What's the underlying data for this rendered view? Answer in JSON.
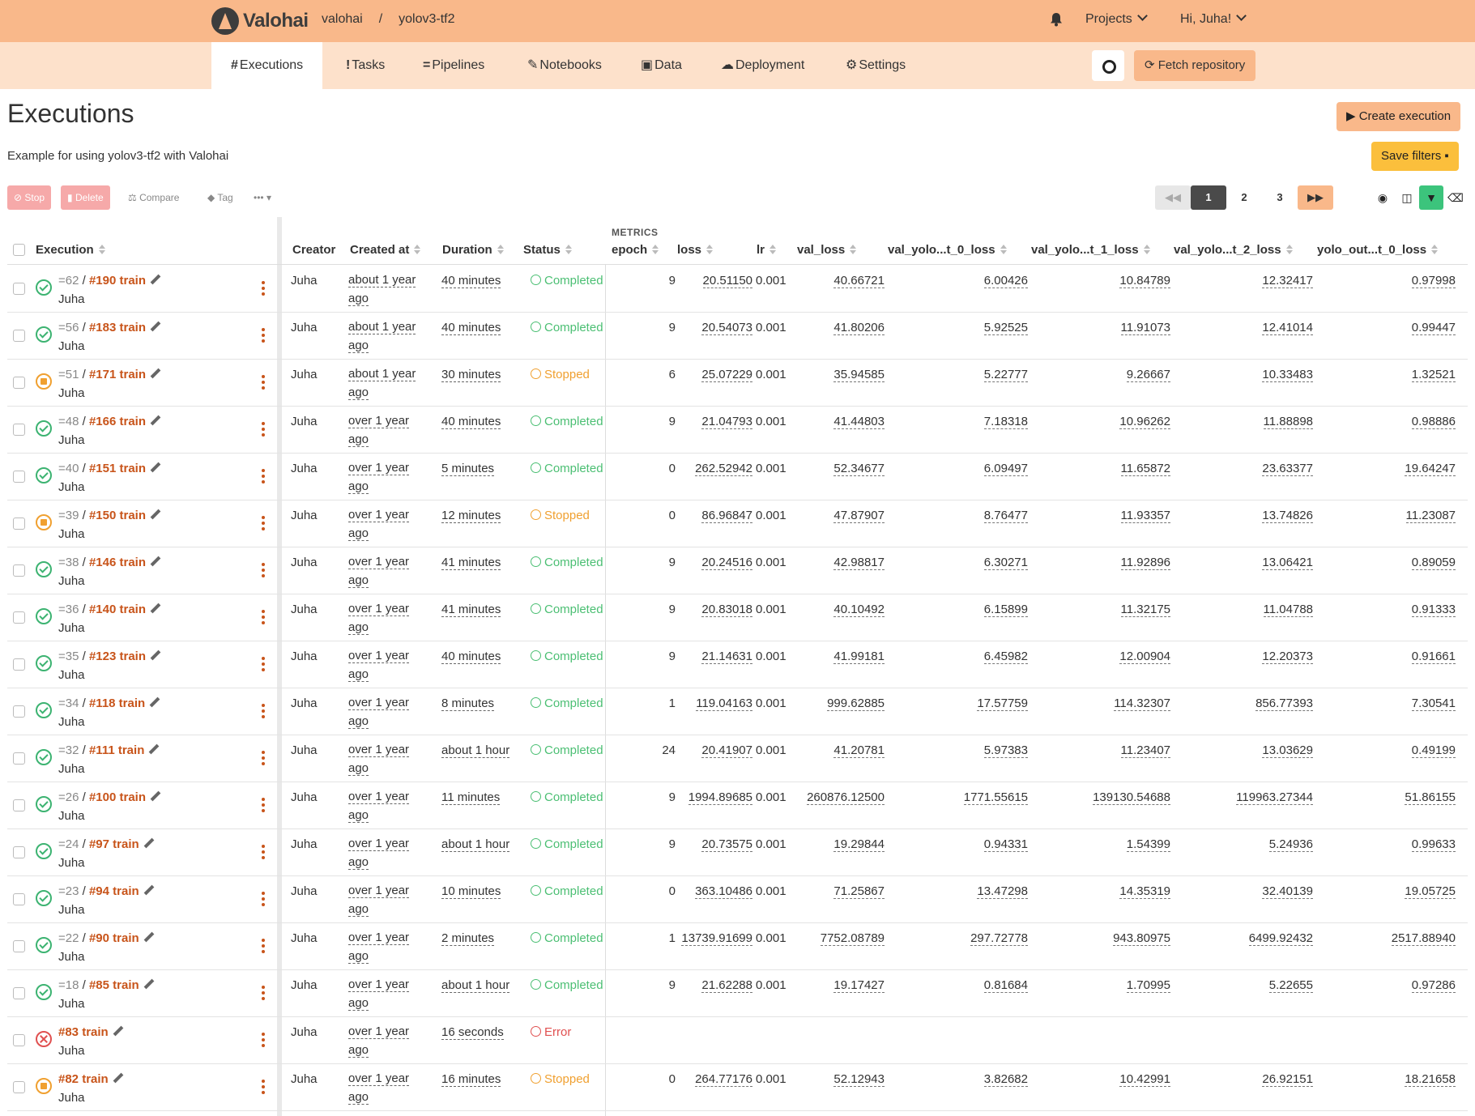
{
  "brand": {
    "name": "Valohai"
  },
  "breadcrumb": {
    "org": "valohai",
    "sep": "/",
    "project": "yolov3-tf2"
  },
  "topnav": {
    "projects": "Projects",
    "user": "Hi, Juha!"
  },
  "tabs": [
    {
      "icon": "#",
      "label": "Executions"
    },
    {
      "icon": "!",
      "label": "Tasks"
    },
    {
      "icon": "=",
      "label": "Pipelines"
    },
    {
      "icon": "✎",
      "label": "Notebooks"
    },
    {
      "icon": "▣",
      "label": "Data"
    },
    {
      "icon": "☁",
      "label": "Deployment"
    },
    {
      "icon": "⚙",
      "label": "Settings"
    }
  ],
  "fetch_label": "Fetch repository",
  "page": {
    "title": "Executions",
    "description": "Example for using yolov3-tf2 with Valohai"
  },
  "buttons": {
    "create": "Create execution",
    "save_filters": "Save filters",
    "stop": "Stop",
    "delete": "Delete",
    "compare": "Compare",
    "tag": "Tag",
    "more": "•••"
  },
  "pagination": {
    "pages": [
      "1",
      "2",
      "3"
    ],
    "current": "1"
  },
  "columns": {
    "execution": "Execution",
    "creator": "Creator",
    "created_at": "Created at",
    "duration": "Duration",
    "status": "Status",
    "metrics_group": "METRICS",
    "epoch": "epoch",
    "loss": "loss",
    "lr": "lr",
    "val_loss": "val_loss",
    "v0": "val_yolo...t_0_loss",
    "v1": "val_yolo...t_1_loss",
    "v2": "val_yolo...t_2_loss",
    "y0": "yolo_out...t_0_loss"
  },
  "rows": [
    {
      "counter": "=62",
      "sep": "/",
      "num": "#190 train",
      "user": "Juha",
      "creator": "Juha",
      "c1": "about 1 year",
      "c2": "ago",
      "duration": "40 minutes",
      "status": "Completed",
      "epoch": "9",
      "loss": "20.51150",
      "lr": "0.001",
      "val_loss": "40.66721",
      "v0": "6.00426",
      "v1": "10.84789",
      "v2": "12.32417",
      "y0": "0.97998"
    },
    {
      "counter": "=56",
      "sep": "/",
      "num": "#183 train",
      "user": "Juha",
      "creator": "Juha",
      "c1": "about 1 year",
      "c2": "ago",
      "duration": "40 minutes",
      "status": "Completed",
      "epoch": "9",
      "loss": "20.54073",
      "lr": "0.001",
      "val_loss": "41.80206",
      "v0": "5.92525",
      "v1": "11.91073",
      "v2": "12.41014",
      "y0": "0.99447"
    },
    {
      "counter": "=51",
      "sep": "/",
      "num": "#171 train",
      "user": "Juha",
      "creator": "Juha",
      "c1": "about 1 year",
      "c2": "ago",
      "duration": "30 minutes",
      "status": "Stopped",
      "epoch": "6",
      "loss": "25.07229",
      "lr": "0.001",
      "val_loss": "35.94585",
      "v0": "5.22777",
      "v1": "9.26667",
      "v2": "10.33483",
      "y0": "1.32521"
    },
    {
      "counter": "=48",
      "sep": "/",
      "num": "#166 train",
      "user": "Juha",
      "creator": "Juha",
      "c1": "over 1 year",
      "c2": "ago",
      "duration": "40 minutes",
      "status": "Completed",
      "epoch": "9",
      "loss": "21.04793",
      "lr": "0.001",
      "val_loss": "41.44803",
      "v0": "7.18318",
      "v1": "10.96262",
      "v2": "11.88898",
      "y0": "0.98886"
    },
    {
      "counter": "=40",
      "sep": "/",
      "num": "#151 train",
      "user": "Juha",
      "creator": "Juha",
      "c1": "over 1 year",
      "c2": "ago",
      "duration": "5 minutes",
      "status": "Completed",
      "epoch": "0",
      "loss": "262.52942",
      "lr": "0.001",
      "val_loss": "52.34677",
      "v0": "6.09497",
      "v1": "11.65872",
      "v2": "23.63377",
      "y0": "19.64247"
    },
    {
      "counter": "=39",
      "sep": "/",
      "num": "#150 train",
      "user": "Juha",
      "creator": "Juha",
      "c1": "over 1 year",
      "c2": "ago",
      "duration": "12 minutes",
      "status": "Stopped",
      "epoch": "0",
      "loss": "86.96847",
      "lr": "0.001",
      "val_loss": "47.87907",
      "v0": "8.76477",
      "v1": "11.93357",
      "v2": "13.74826",
      "y0": "11.23087"
    },
    {
      "counter": "=38",
      "sep": "/",
      "num": "#146 train",
      "user": "Juha",
      "creator": "Juha",
      "c1": "over 1 year",
      "c2": "ago",
      "duration": "41 minutes",
      "status": "Completed",
      "epoch": "9",
      "loss": "20.24516",
      "lr": "0.001",
      "val_loss": "42.98817",
      "v0": "6.30271",
      "v1": "11.92896",
      "v2": "13.06421",
      "y0": "0.89059"
    },
    {
      "counter": "=36",
      "sep": "/",
      "num": "#140 train",
      "user": "Juha",
      "creator": "Juha",
      "c1": "over 1 year",
      "c2": "ago",
      "duration": "41 minutes",
      "status": "Completed",
      "epoch": "9",
      "loss": "20.83018",
      "lr": "0.001",
      "val_loss": "40.10492",
      "v0": "6.15899",
      "v1": "11.32175",
      "v2": "11.04788",
      "y0": "0.91333"
    },
    {
      "counter": "=35",
      "sep": "/",
      "num": "#123 train",
      "user": "Juha",
      "creator": "Juha",
      "c1": "over 1 year",
      "c2": "ago",
      "duration": "40 minutes",
      "status": "Completed",
      "epoch": "9",
      "loss": "21.14631",
      "lr": "0.001",
      "val_loss": "41.99181",
      "v0": "6.45982",
      "v1": "12.00904",
      "v2": "12.20373",
      "y0": "0.91661"
    },
    {
      "counter": "=34",
      "sep": "/",
      "num": "#118 train",
      "user": "Juha",
      "creator": "Juha",
      "c1": "over 1 year",
      "c2": "ago",
      "duration": "8 minutes",
      "status": "Completed",
      "epoch": "1",
      "loss": "119.04163",
      "lr": "0.001",
      "val_loss": "999.62885",
      "v0": "17.57759",
      "v1": "114.32307",
      "v2": "856.77393",
      "y0": "7.30541"
    },
    {
      "counter": "=32",
      "sep": "/",
      "num": "#111 train",
      "user": "Juha",
      "creator": "Juha",
      "c1": "over 1 year",
      "c2": "ago",
      "duration": "about 1 hour",
      "status": "Completed",
      "epoch": "24",
      "loss": "20.41907",
      "lr": "0.001",
      "val_loss": "41.20781",
      "v0": "5.97383",
      "v1": "11.23407",
      "v2": "13.03629",
      "y0": "0.49199"
    },
    {
      "counter": "=26",
      "sep": "/",
      "num": "#100 train",
      "user": "Juha",
      "creator": "Juha",
      "c1": "over 1 year",
      "c2": "ago",
      "duration": "11 minutes",
      "status": "Completed",
      "epoch": "9",
      "loss": "1994.89685",
      "lr": "0.001",
      "val_loss": "260876.12500",
      "v0": "1771.55615",
      "v1": "139130.54688",
      "v2": "119963.27344",
      "y0": "51.86155"
    },
    {
      "counter": "=24",
      "sep": "/",
      "num": "#97 train",
      "user": "Juha",
      "creator": "Juha",
      "c1": "over 1 year",
      "c2": "ago",
      "duration": "about 1 hour",
      "status": "Completed",
      "epoch": "9",
      "loss": "20.73575",
      "lr": "0.001",
      "val_loss": "19.29844",
      "v0": "0.94331",
      "v1": "1.54399",
      "v2": "5.24936",
      "y0": "0.99633"
    },
    {
      "counter": "=23",
      "sep": "/",
      "num": "#94 train",
      "user": "Juha",
      "creator": "Juha",
      "c1": "over 1 year",
      "c2": "ago",
      "duration": "10 minutes",
      "status": "Completed",
      "epoch": "0",
      "loss": "363.10486",
      "lr": "0.001",
      "val_loss": "71.25867",
      "v0": "13.47298",
      "v1": "14.35319",
      "v2": "32.40139",
      "y0": "19.05725"
    },
    {
      "counter": "=22",
      "sep": "/",
      "num": "#90 train",
      "user": "Juha",
      "creator": "Juha",
      "c1": "over 1 year",
      "c2": "ago",
      "duration": "2 minutes",
      "status": "Completed",
      "epoch": "1",
      "loss": "13739.91699",
      "lr": "0.001",
      "val_loss": "7752.08789",
      "v0": "297.72778",
      "v1": "943.80975",
      "v2": "6499.92432",
      "y0": "2517.88940"
    },
    {
      "counter": "=18",
      "sep": "/",
      "num": "#85 train",
      "user": "Juha",
      "creator": "Juha",
      "c1": "over 1 year",
      "c2": "ago",
      "duration": "about 1 hour",
      "status": "Completed",
      "epoch": "9",
      "loss": "21.62288",
      "lr": "0.001",
      "val_loss": "19.17427",
      "v0": "0.81684",
      "v1": "1.70995",
      "v2": "5.22655",
      "y0": "0.97286"
    },
    {
      "counter": "",
      "sep": "",
      "num": "#83 train",
      "user": "Juha",
      "creator": "Juha",
      "c1": "over 1 year",
      "c2": "ago",
      "duration": "16 seconds",
      "status": "Error",
      "epoch": "",
      "loss": "",
      "lr": "",
      "val_loss": "",
      "v0": "",
      "v1": "",
      "v2": "",
      "y0": ""
    },
    {
      "counter": "",
      "sep": "",
      "num": "#82 train",
      "user": "Juha",
      "creator": "Juha",
      "c1": "over 1 year",
      "c2": "ago",
      "duration": "16 minutes",
      "status": "Stopped",
      "epoch": "0",
      "loss": "264.77176",
      "lr": "0.001",
      "val_loss": "52.12943",
      "v0": "3.82682",
      "v1": "10.42991",
      "v2": "26.92151",
      "y0": "18.21658"
    }
  ]
}
